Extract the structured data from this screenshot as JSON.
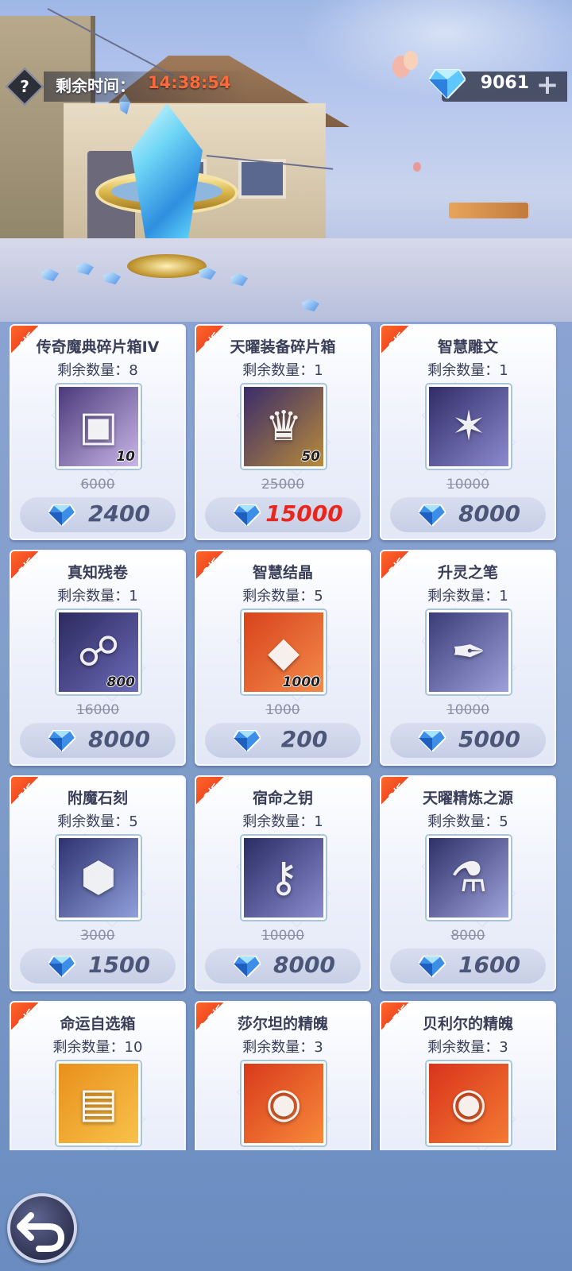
{
  "header": {
    "help_icon": "question-icon",
    "timer_label": "剩余时间：",
    "timer_value": "14:38:54",
    "currency_icon": "diamond-icon",
    "currency_value": "9061",
    "add_label": "+"
  },
  "colors": {
    "timer_value": "#ff6a3a",
    "discount_ribbon": "#e8341c",
    "price_highlight": "#e8261e",
    "price_normal": "#4c5678"
  },
  "items": [
    {
      "discount": "4折",
      "name": "传奇魔典碎片箱IV",
      "stock": "剩余数量：8",
      "qty": "10",
      "original": "6000",
      "price": "2400",
      "icon": "chest-icon",
      "icon_bg": [
        "#4a3a7a",
        "#c9b6e8"
      ],
      "glyph": "▣",
      "price_red": false
    },
    {
      "discount": "6折",
      "name": "天曜装备碎片箱",
      "stock": "剩余数量：1",
      "qty": "50",
      "original": "25000",
      "price": "15000",
      "icon": "helmet-icon",
      "icon_bg": [
        "#3a2c6a",
        "#b88a3a"
      ],
      "glyph": "♛",
      "price_red": true
    },
    {
      "discount": "8折",
      "name": "智慧雕文",
      "stock": "剩余数量：1",
      "qty": "",
      "original": "10000",
      "price": "8000",
      "icon": "rune-star-icon",
      "icon_bg": [
        "#2f2c66",
        "#8c8ad0"
      ],
      "glyph": "✶",
      "price_red": false
    },
    {
      "discount": "5折",
      "name": "真知残卷",
      "stock": "剩余数量：1",
      "qty": "800",
      "original": "16000",
      "price": "8000",
      "icon": "scroll-icon",
      "icon_bg": [
        "#2c2a5e",
        "#6c6ab8"
      ],
      "glyph": "☍",
      "price_red": false
    },
    {
      "discount": "2折",
      "name": "智慧结晶",
      "stock": "剩余数量：5",
      "qty": "1000",
      "original": "1000",
      "price": "200",
      "icon": "crystal-icon",
      "icon_bg": [
        "#d8431c",
        "#f38a4a"
      ],
      "glyph": "◆",
      "price_red": false
    },
    {
      "discount": "5折",
      "name": "升灵之笔",
      "stock": "剩余数量：1",
      "qty": "",
      "original": "10000",
      "price": "5000",
      "icon": "quill-icon",
      "icon_bg": [
        "#3a3c78",
        "#9ea0dc"
      ],
      "glyph": "✒",
      "price_red": false
    },
    {
      "discount": "5折",
      "name": "附魔石刻",
      "stock": "剩余数量：5",
      "qty": "",
      "original": "3000",
      "price": "1500",
      "icon": "hex-stone-icon",
      "icon_bg": [
        "#2f3270",
        "#8fa0dc"
      ],
      "glyph": "⬢",
      "price_red": false
    },
    {
      "discount": "8折",
      "name": "宿命之钥",
      "stock": "剩余数量：1",
      "qty": "",
      "original": "10000",
      "price": "8000",
      "icon": "key-icon",
      "icon_bg": [
        "#2a2c64",
        "#8a8cd0"
      ],
      "glyph": "⚷",
      "price_red": false
    },
    {
      "discount": "2折",
      "name": "天曜精炼之源",
      "stock": "剩余数量：5",
      "qty": "",
      "original": "8000",
      "price": "1600",
      "icon": "vial-icon",
      "icon_bg": [
        "#2e3068",
        "#a0a4dc"
      ],
      "glyph": "⚗",
      "price_red": false
    },
    {
      "discount": "2折",
      "name": "命运自选箱",
      "stock": "剩余数量：10",
      "qty": "",
      "original": "",
      "price": "",
      "icon": "treasure-box-icon",
      "icon_bg": [
        "#e8901c",
        "#f8c24a"
      ],
      "glyph": "▤",
      "price_red": false
    },
    {
      "discount": "1.7折",
      "name": "莎尔坦的精魄",
      "stock": "剩余数量：3",
      "qty": "",
      "original": "",
      "price": "",
      "icon": "orb-icon",
      "icon_bg": [
        "#d83a1c",
        "#f88a3a"
      ],
      "glyph": "◉",
      "price_red": false
    },
    {
      "discount": "1.7折",
      "name": "贝利尔的精魄",
      "stock": "剩余数量：3",
      "qty": "",
      "original": "",
      "price": "",
      "icon": "orb-icon",
      "icon_bg": [
        "#d8341c",
        "#f47a32"
      ],
      "glyph": "◉",
      "price_red": false
    }
  ],
  "footer": {
    "back_icon": "back-arrow-icon"
  }
}
